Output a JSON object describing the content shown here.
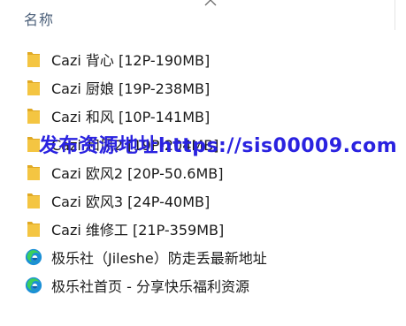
{
  "header": {
    "name_column": "名称"
  },
  "files": [
    {
      "name": "Cazi 背心 [12P-190MB]",
      "type": "folder",
      "icon": "folder-icon"
    },
    {
      "name": "Cazi 厨娘 [19P-238MB]",
      "type": "folder",
      "icon": "folder-icon"
    },
    {
      "name": "Cazi 和风 [10P-141MB]",
      "type": "folder",
      "icon": "folder-icon"
    },
    {
      "name": "Cazi 和风2 [19P-204MB]",
      "type": "folder",
      "icon": "folder-icon"
    },
    {
      "name": "Cazi 欧风2 [20P-50.6MB]",
      "type": "folder",
      "icon": "folder-icon"
    },
    {
      "name": "Cazi 欧风3 [24P-40MB]",
      "type": "folder",
      "icon": "folder-icon"
    },
    {
      "name": "Cazi 维修工 [21P-359MB]",
      "type": "folder",
      "icon": "folder-icon"
    },
    {
      "name": "极乐社（Jileshe）防走丢最新地址",
      "type": "link",
      "icon": "edge-icon"
    },
    {
      "name": "极乐社首页 - 分享快乐福利资源",
      "type": "link",
      "icon": "edge-icon"
    }
  ],
  "watermark": "发布资源地址https://sis00009.com",
  "colors": {
    "folder": "#f4c542",
    "folder_dark": "#e0a924",
    "watermark": "#2a22e0",
    "header_text": "#4c607a"
  }
}
